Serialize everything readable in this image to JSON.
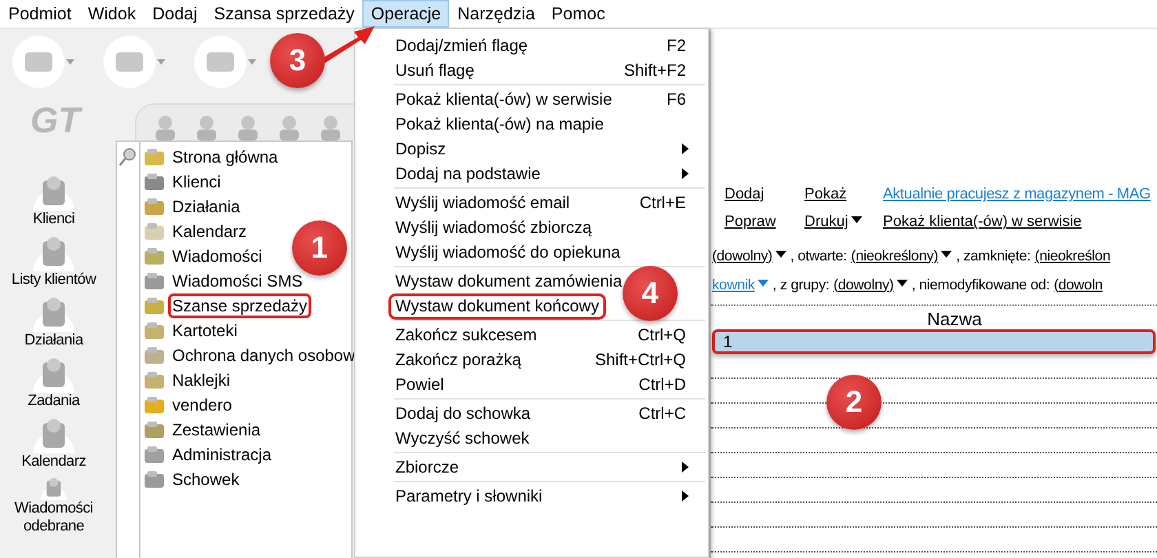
{
  "menubar": [
    {
      "label": "Podmiot",
      "selected": false
    },
    {
      "label": "Widok",
      "selected": false
    },
    {
      "label": "Dodaj",
      "selected": false
    },
    {
      "label": "Szansa sprzedaży",
      "selected": false
    },
    {
      "label": "Operacje",
      "selected": true
    },
    {
      "label": "Narzędzia",
      "selected": false
    },
    {
      "label": "Pomoc",
      "selected": false
    }
  ],
  "logo": "GT",
  "nav_items": [
    "Klienci",
    "Listy klientów",
    "Działania",
    "Zadania",
    "Kalendarz",
    "Wiadomości odebrane"
  ],
  "tree": [
    {
      "label": "Strona główna",
      "marked": false
    },
    {
      "label": "Klienci",
      "marked": false
    },
    {
      "label": "Działania",
      "marked": false
    },
    {
      "label": "Kalendarz",
      "marked": false
    },
    {
      "label": "Wiadomości",
      "marked": false
    },
    {
      "label": "Wiadomości SMS",
      "marked": false
    },
    {
      "label": "Szanse sprzedaży",
      "marked": true
    },
    {
      "label": "Kartoteki",
      "marked": false
    },
    {
      "label": "Ochrona danych osobow",
      "marked": false
    },
    {
      "label": "Naklejki",
      "marked": false
    },
    {
      "label": "vendero",
      "marked": false
    },
    {
      "label": "Zestawienia",
      "marked": false
    },
    {
      "label": "Administracja",
      "marked": false
    },
    {
      "label": "Schowek",
      "marked": false
    }
  ],
  "menu": [
    [
      {
        "label": "Dodaj/zmień flagę",
        "shortcut": "F2",
        "submenu": false,
        "marked": false
      },
      {
        "label": "Usuń flagę",
        "shortcut": "Shift+F2",
        "submenu": false,
        "marked": false
      }
    ],
    [
      {
        "label": "Pokaż klienta(-ów) w serwisie",
        "shortcut": "F6",
        "submenu": false,
        "marked": false
      },
      {
        "label": "Pokaż klienta(-ów) na mapie",
        "submenu": false,
        "marked": false
      },
      {
        "label": "Dopisz",
        "submenu": true,
        "marked": false
      },
      {
        "label": "Dodaj na podstawie",
        "submenu": true,
        "marked": false
      }
    ],
    [
      {
        "label": "Wyślij wiadomość email",
        "shortcut": "Ctrl+E",
        "submenu": false,
        "marked": false
      },
      {
        "label": "Wyślij wiadomość zbiorczą",
        "submenu": false,
        "marked": false
      },
      {
        "label": "Wyślij wiadomość do opiekuna",
        "submenu": false,
        "marked": false
      }
    ],
    [
      {
        "label": "Wystaw dokument zamówienia",
        "submenu": false,
        "marked": false
      },
      {
        "label": "Wystaw dokument końcowy",
        "submenu": false,
        "marked": true
      }
    ],
    [
      {
        "label": "Zakończ sukcesem",
        "shortcut": "Ctrl+Q",
        "submenu": false,
        "marked": false
      },
      {
        "label": "Zakończ porażką",
        "shortcut": "Shift+Ctrl+Q",
        "submenu": false,
        "marked": false
      },
      {
        "label": "Powiel",
        "shortcut": "Ctrl+D",
        "submenu": false,
        "marked": false
      }
    ],
    [
      {
        "label": "Dodaj do schowka",
        "shortcut": "Ctrl+C",
        "submenu": false,
        "marked": false
      },
      {
        "label": "Wyczyść schowek",
        "submenu": false,
        "marked": false
      }
    ],
    [
      {
        "label": "Zbiorcze",
        "submenu": true,
        "marked": false
      }
    ],
    [
      {
        "label": "Parametry i słowniki",
        "submenu": true,
        "marked": false
      }
    ]
  ],
  "actions": [
    [
      {
        "label": "Dodaj",
        "kind": "action",
        "dropdown": false
      },
      {
        "label": "Pokaż",
        "kind": "action",
        "dropdown": false
      },
      {
        "label": "Aktualnie pracujesz z magazynem - MAG",
        "kind": "info",
        "dropdown": false
      }
    ],
    [
      {
        "label": "Popraw",
        "kind": "action",
        "dropdown": false
      },
      {
        "label": "Drukuj",
        "kind": "action",
        "dropdown": true
      },
      {
        "label": "Pokaż klienta(-ów) w serwisie",
        "kind": "action",
        "dropdown": false
      }
    ]
  ],
  "filters": [
    [
      {
        "text": "(dowolny)",
        "kind": "value",
        "dropdown": true
      },
      {
        "text": ", otwarte:",
        "kind": "label",
        "dropdown": false
      },
      {
        "text": "(nieokreślony)",
        "kind": "value",
        "dropdown": true
      },
      {
        "text": ", zamknięte:",
        "kind": "label",
        "dropdown": false
      },
      {
        "text": "(nieokreślon",
        "kind": "value",
        "dropdown": false
      }
    ],
    [
      {
        "text": "kownik",
        "kind": "link",
        "dropdown": true
      },
      {
        "text": ", z grupy:",
        "kind": "label",
        "dropdown": false
      },
      {
        "text": "(dowolny)",
        "kind": "value",
        "dropdown": true
      },
      {
        "text": ", niemodyfikowane od:",
        "kind": "label",
        "dropdown": false
      },
      {
        "text": "(dowoln",
        "kind": "value",
        "dropdown": false
      }
    ]
  ],
  "table": {
    "columns": [
      "Nazwa"
    ],
    "rows": [
      {
        "cells": [
          "1"
        ],
        "selected": true,
        "marked": true
      }
    ]
  },
  "callouts": [
    "1",
    "2",
    "3",
    "4"
  ]
}
